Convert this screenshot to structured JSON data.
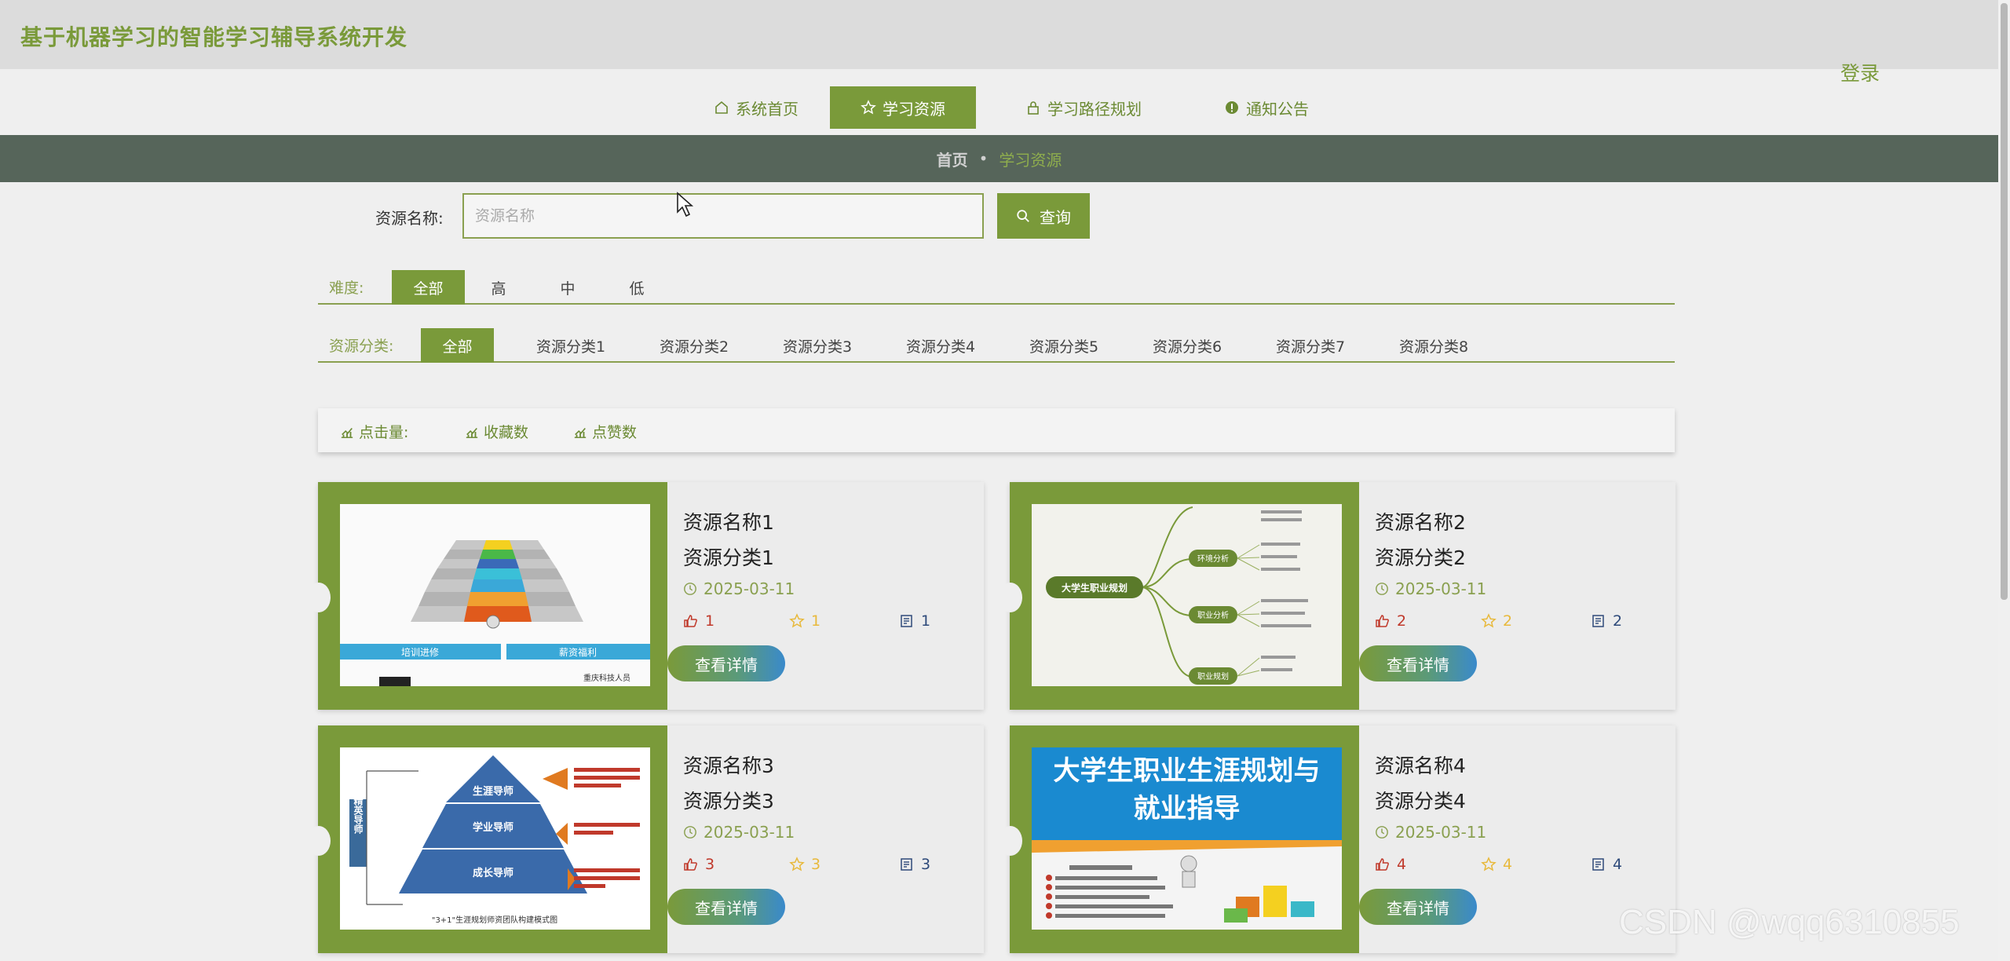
{
  "app": {
    "title": "基于机器学习的智能学习辅导系统开发",
    "login": "登录"
  },
  "nav": [
    {
      "label": "系统首页",
      "icon": "home-icon"
    },
    {
      "label": "学习资源",
      "icon": "star-icon",
      "active": true
    },
    {
      "label": "学习路径规划",
      "icon": "lock-icon"
    },
    {
      "label": "通知公告",
      "icon": "alert-circle-icon"
    }
  ],
  "breadcrumb": {
    "home": "首页",
    "separator": "•",
    "current": "学习资源"
  },
  "search": {
    "label": "资源名称:",
    "placeholder": "资源名称",
    "value": "",
    "button": "查询"
  },
  "difficulty": {
    "label": "难度:",
    "options": [
      "全部",
      "高",
      "中",
      "低"
    ],
    "selected": "全部"
  },
  "category": {
    "label": "资源分类:",
    "options": [
      "全部",
      "资源分类1",
      "资源分类2",
      "资源分类3",
      "资源分类4",
      "资源分类5",
      "资源分类6",
      "资源分类7",
      "资源分类8"
    ],
    "selected": "全部"
  },
  "sort": [
    "点击量:",
    "收藏数",
    "点赞数"
  ],
  "cards": [
    {
      "name": "资源名称1",
      "category": "资源分类1",
      "date": "2025-03-11",
      "likes": "1",
      "favorites": "1",
      "views": "1",
      "button": "查看详情",
      "image": "staircase-infographic"
    },
    {
      "name": "资源名称2",
      "category": "资源分类2",
      "date": "2025-03-11",
      "likes": "2",
      "favorites": "2",
      "views": "2",
      "button": "查看详情",
      "image": "mindmap",
      "image_title": "大学生职业规划"
    },
    {
      "name": "资源名称3",
      "category": "资源分类3",
      "date": "2025-03-11",
      "likes": "3",
      "favorites": "3",
      "views": "3",
      "button": "查看详情",
      "image": "pyramid"
    },
    {
      "name": "资源名称4",
      "category": "资源分类4",
      "date": "2025-03-11",
      "likes": "4",
      "favorites": "4",
      "views": "4",
      "button": "查看详情",
      "image": "book-cover",
      "image_title": "大学生职业生涯规划与就业指导"
    }
  ],
  "card1_image_text": {
    "left": "培训进修",
    "right": "薪资福利",
    "sub": "重庆科技人员"
  },
  "card2_image_text": {
    "n1": "环境分析",
    "n2": "职业分析",
    "n3": "职业规划"
  },
  "card3_image_text": {
    "side": "精英导师",
    "t1": "生涯导师",
    "t2": "学业导师",
    "t3": "成长导师",
    "caption": "\"3+1\"生涯规划师资团队构建模式图"
  },
  "watermark": "CSDN @wqq6310855",
  "colors": {
    "accent": "#7a9a3a",
    "band": "#56655a",
    "like": "#c0392b",
    "fav": "#e8b93c",
    "view": "#2e4a7a"
  }
}
